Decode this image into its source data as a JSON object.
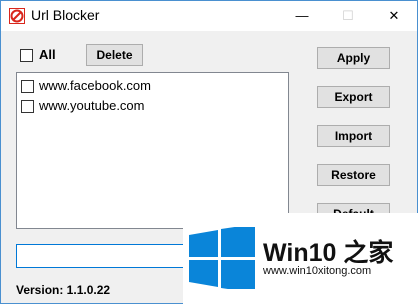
{
  "window": {
    "title": "Url Blocker",
    "icon": "no-entry-icon"
  },
  "controls": {
    "minimize": "—",
    "maximize": "☐",
    "close": "✕"
  },
  "top": {
    "all_label": "All",
    "delete_label": "Delete"
  },
  "list": {
    "items": [
      "www.facebook.com",
      "www.youtube.com"
    ]
  },
  "buttons": {
    "apply": "Apply",
    "export": "Export",
    "import": "Import",
    "restore": "Restore",
    "default": "Default"
  },
  "input": {
    "value": ""
  },
  "version": "Version: 1.1.0.22",
  "watermark": {
    "title": "Win10 之家",
    "url": "www.win10xitong.com"
  },
  "colors": {
    "accent": "#0078d7",
    "icon_red": "#d9261c"
  }
}
